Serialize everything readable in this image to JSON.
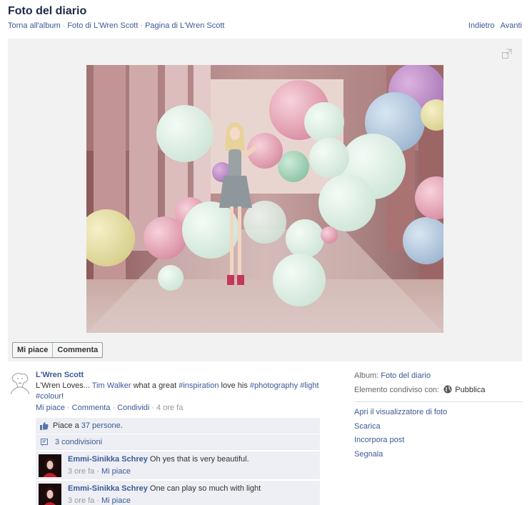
{
  "header": {
    "title": "Foto del diario",
    "breadcrumbs": [
      "Torna all'album",
      "Foto di L'Wren Scott",
      "Pagina di L'Wren Scott"
    ],
    "prev": "Indietro",
    "next": "Avanti"
  },
  "photo": {
    "icon": "expand-icon"
  },
  "actions": {
    "like": "Mi piace",
    "comment": "Commenta"
  },
  "post": {
    "author": "L'Wren Scott",
    "caption_prefix": "L'Wren Loves... ",
    "tagged": "Tim Walker",
    "caption_mid": " what a great ",
    "tag_inspiration": "#inspiration",
    "caption_love": " love his ",
    "tag_photography": "#photography",
    "tag_light": "#light",
    "tag_colour": "#colour",
    "caption_end": "!",
    "meta": {
      "like": "Mi piace",
      "comment": "Commenta",
      "share": "Condividi",
      "time": "4 ore fa"
    },
    "likes": {
      "prefix": "Piace a ",
      "link": "37 persone",
      "suffix": "."
    },
    "shares": "3 condivisioni",
    "comments": [
      {
        "author": "Emmi-Sinikka Schrey",
        "text": "Oh yes that is very beautiful.",
        "time": "3 ore fa",
        "like": "Mi piace"
      },
      {
        "author": "Emmi-Sinikka Schrey",
        "text": "One can play so much with light",
        "time": "3 ore fa",
        "like": "Mi piace"
      }
    ]
  },
  "sidebar": {
    "album_label": "Album:",
    "album_value": "Foto del diario",
    "shared_label": "Elemento condiviso con:",
    "shared_value": "Pubblica",
    "links": [
      "Apri il visualizzatore di foto",
      "Scarica",
      "Incorpora post",
      "Segnala"
    ]
  }
}
